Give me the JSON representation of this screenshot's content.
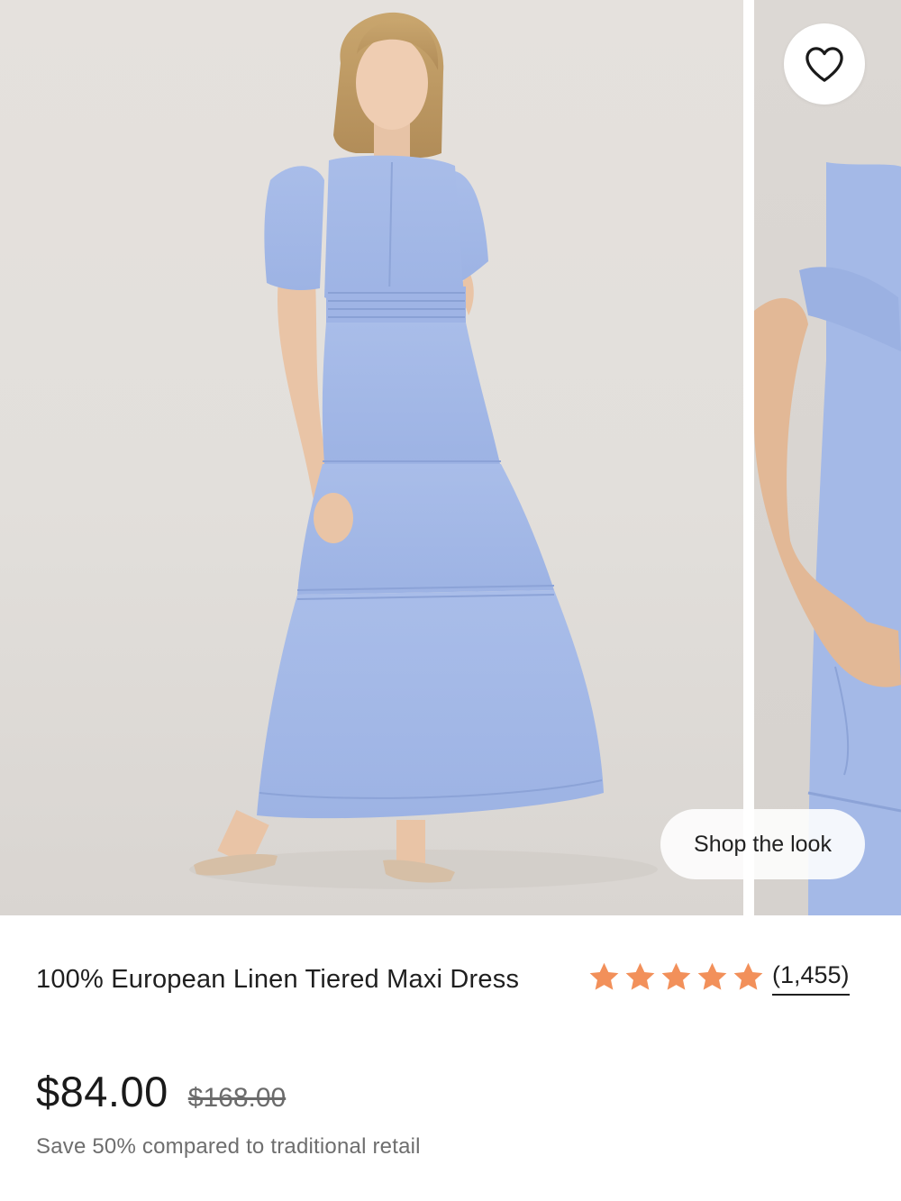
{
  "gallery": {
    "main_image_alt": "",
    "favorite_icon": "heart-outline-icon",
    "shop_the_look_label": "Shop the look"
  },
  "product": {
    "title": "100% European Linen Tiered Maxi Dress",
    "rating": {
      "stars": 5,
      "max_stars": 5,
      "review_count_label": "(1,455)",
      "star_color": "#f2905a"
    },
    "price": "$84.00",
    "compare_at_price": "$168.00",
    "savings_text": "Save 50% compared to traditional retail"
  },
  "colors": {
    "dress": "#a3b8e6",
    "background": "#e4e0dc",
    "text": "#1f1f1f",
    "muted_text": "#6e6e6e"
  }
}
